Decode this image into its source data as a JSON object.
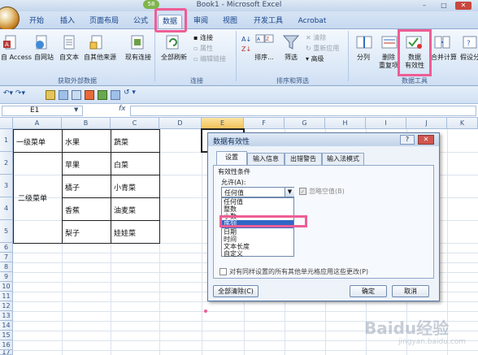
{
  "window": {
    "title": "Book1 - Microsoft Excel",
    "notify_count": "58"
  },
  "tabs": [
    "开始",
    "插入",
    "页面布局",
    "公式",
    "数据",
    "审阅",
    "视图",
    "开发工具",
    "Acrobat"
  ],
  "ribbon": {
    "get_external": {
      "label": "获取外部数据",
      "buttons": [
        "自 Access",
        "自网站",
        "自文本",
        "自其他来源",
        "现有连接"
      ]
    },
    "connections": {
      "label": "连接",
      "refresh": "全部刷新",
      "items": [
        "连接",
        "属性",
        "编辑链接"
      ]
    },
    "sort_filter": {
      "label": "排序和筛选",
      "sort": "排序...",
      "filter": "筛选",
      "items": [
        "清除",
        "重新应用",
        "高级"
      ]
    },
    "data_tools": {
      "label": "数据工具",
      "split": "分列",
      "remove_dup": "删除\n重复项",
      "validation": "数据\n有效性",
      "consolidate": "合并计算",
      "whatif": "假设分"
    }
  },
  "formula_bar": {
    "name_box": "E1",
    "fx": "fx"
  },
  "columns": [
    "A",
    "B",
    "C",
    "D",
    "E",
    "F",
    "G",
    "H",
    "I",
    "J",
    "K"
  ],
  "rows": [
    "1",
    "2",
    "3",
    "4",
    "5",
    "6",
    "7",
    "8",
    "9",
    "10",
    "11",
    "12",
    "13",
    "14",
    "15",
    "16",
    "17"
  ],
  "cells": {
    "a1": "一级菜单",
    "a_merge": "二级菜单",
    "b1": "水果",
    "b2": "苹果",
    "b3": "橘子",
    "b4": "香蕉",
    "b5": "梨子",
    "c1": "蔬菜",
    "c2": "白菜",
    "c3": "小青菜",
    "c4": "油麦菜",
    "c5": "娃娃菜"
  },
  "dialog": {
    "title": "数据有效性",
    "tabs": [
      "设置",
      "输入信息",
      "出错警告",
      "输入法模式"
    ],
    "group_label": "有效性条件",
    "allow_label": "允许(A):",
    "allow_value": "任何值",
    "ignore_blank": "忽略空值(B)",
    "dropdown_items": [
      "任何值",
      "整数",
      "小数",
      "序列",
      "日期",
      "时间",
      "文本长度",
      "自定义"
    ],
    "apply_all": "对有同样设置的所有其他单元格应用这些更改(P)",
    "clear_all": "全部清除(C)",
    "ok": "确定",
    "cancel": "取消"
  },
  "watermark": "Baidu经验",
  "watermark_url": "jingyan.baidu.com",
  "highlight_color": "#ee5d95"
}
